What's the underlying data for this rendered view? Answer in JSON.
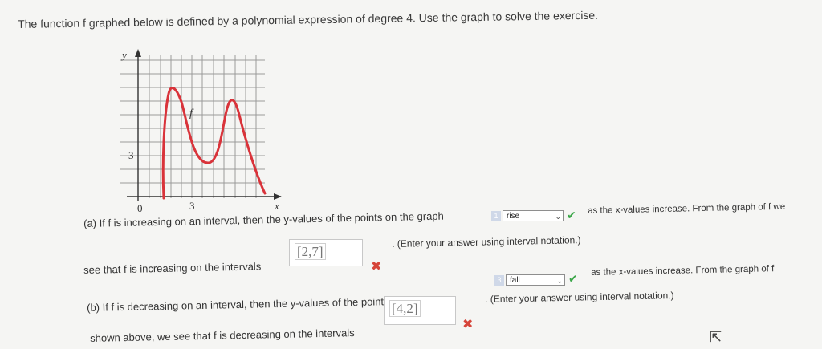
{
  "prompt": "The function f graphed below is defined by a polynomial expression of degree 4. Use the graph to solve the exercise.",
  "graph": {
    "y_axis_label": "y",
    "x_axis_label": "x",
    "curve_label": "f",
    "tick_labels": {
      "origin": "0",
      "x": "3",
      "y": "3"
    },
    "colors": {
      "curve": "#d9333a",
      "grid": "#9a9a9a",
      "axis": "#333333"
    }
  },
  "part_a": {
    "line1_prefix": "(a) If f is increasing on an interval, then the y-values of the points on the graph",
    "select_index": "1",
    "select_value": "rise",
    "line1_suffix": "as the x-values increase. From the graph of f we",
    "line2_prefix": "see that f is increasing on the intervals",
    "answer": "[2,7]",
    "hint": ". (Enter your answer using interval notation.)"
  },
  "part_b": {
    "line1_prefix": "(b) If f is decreasing on an interval, then the y-values of the points on the graph",
    "select_index": "3",
    "select_value": "fall",
    "line1_suffix": "as the x-values increase. From the graph of f",
    "line2_prefix": "shown above, we see that f is decreasing on the intervals",
    "answer": "[4,2]",
    "hint": ". (Enter your answer using interval notation.)"
  },
  "status_colors": {
    "correct": "#3aa648",
    "incorrect": "#d6453a"
  }
}
